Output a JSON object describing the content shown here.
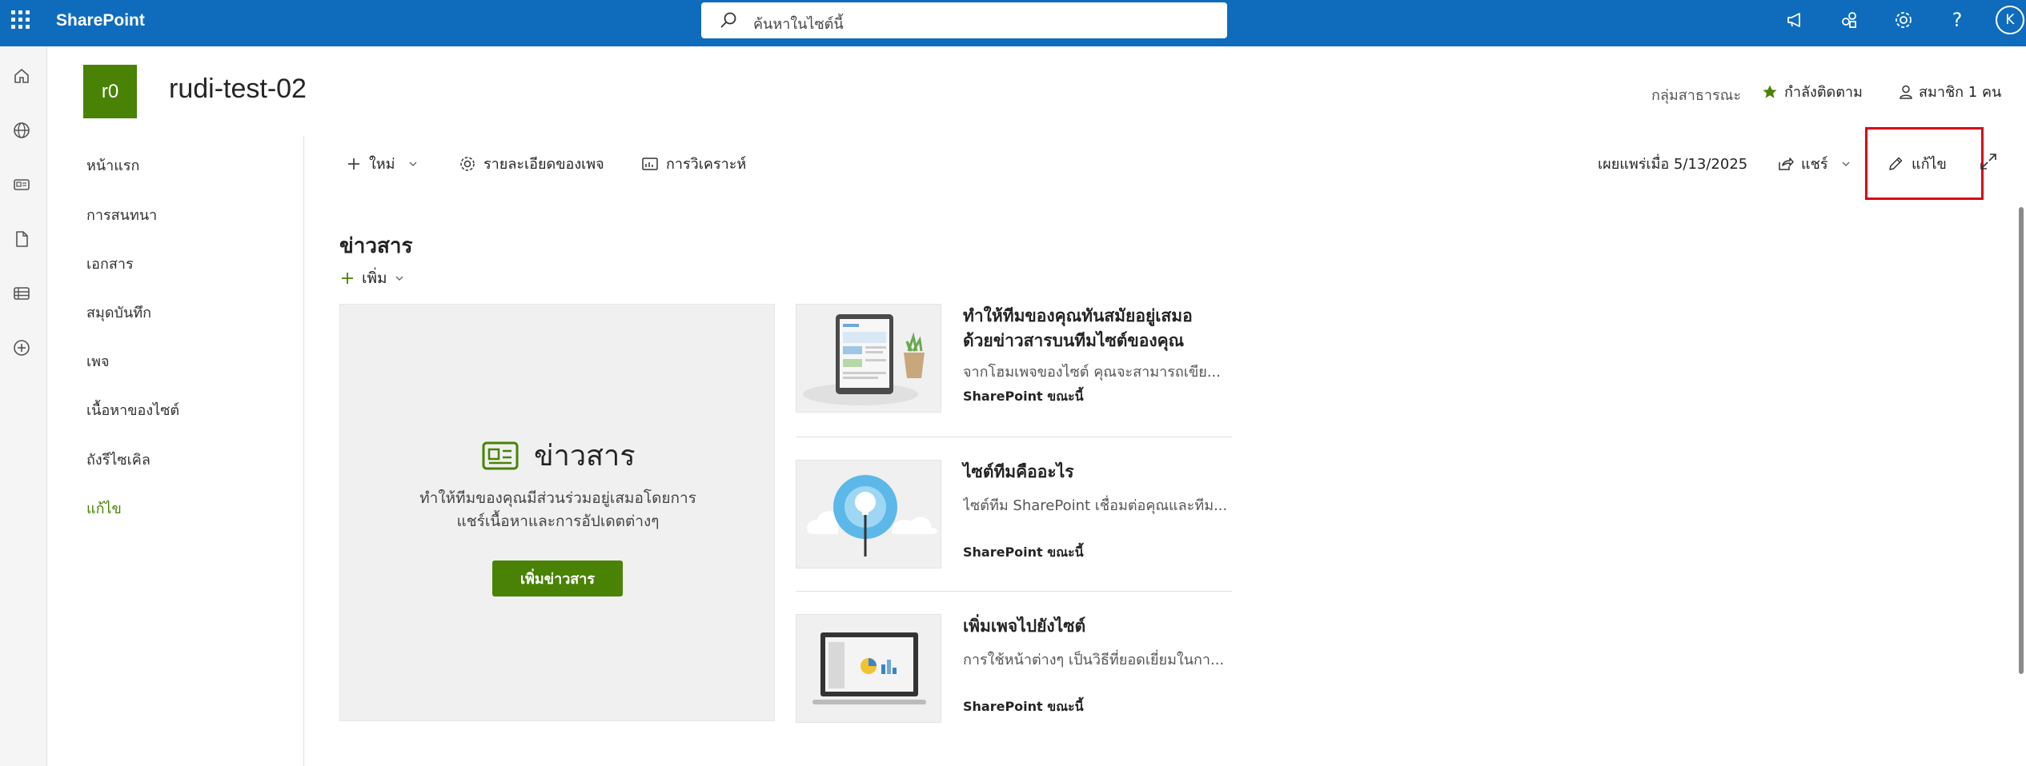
{
  "suite": {
    "brand": "SharePoint",
    "search_placeholder": "ค้นหาในไซต์นี้",
    "avatar_initial": "K"
  },
  "site": {
    "logo_text": "r0",
    "title": "rudi-test-02",
    "group_type": "กลุ่มสาธารณะ",
    "follow_label": "กำลังติดตาม",
    "members_label": "สมาชิก 1 คน"
  },
  "nav": {
    "items": [
      {
        "label": "หน้าแรก"
      },
      {
        "label": "การสนทนา"
      },
      {
        "label": "เอกสาร"
      },
      {
        "label": "สมุดบันทึก"
      },
      {
        "label": "เพจ"
      },
      {
        "label": "เนื้อหาของไซต์"
      },
      {
        "label": "ถังรีไซเคิล"
      },
      {
        "label": "แก้ไข"
      }
    ]
  },
  "commandbar": {
    "new_label": "ใหม่",
    "page_details_label": "รายละเอียดของเพจ",
    "analytics_label": "การวิเคราะห์",
    "published_label": "เผยแพร่เมื่อ 5/13/2025",
    "share_label": "แชร์",
    "edit_label": "แก้ไข"
  },
  "news": {
    "heading": "ข่าวสาร",
    "add_label": "เพิ่ม",
    "hero_title": "ข่าวสาร",
    "hero_desc_line1": "ทำให้ทีมของคุณมีส่วนร่วมอยู่เสมอโดยการ",
    "hero_desc_line2": "แชร์เนื้อหาและการอัปเดตต่างๆ",
    "hero_button": "เพิ่มข่าวสาร",
    "cards": [
      {
        "title_line1": "ทำให้ทีมของคุณทันสมัยอยู่เสมอ",
        "title_line2": "ด้วยข่าวสารบนทีมไซต์ของคุณ",
        "desc": "จากโฮมเพจของไซต์ คุณจะสามารถเขีย...",
        "meta": "SharePoint ขณะนี้"
      },
      {
        "title_line1": "ไซต์ทีมคืออะไร",
        "desc": "ไซต์ทีม SharePoint เชื่อมต่อคุณและทีม...",
        "meta": "SharePoint ขณะนี้"
      },
      {
        "title_line1": "เพิ่มเพจไปยังไซต์",
        "desc": "การใช้หน้าต่างๆ เป็นวิธีที่ยอดเยี่ยมในกา...",
        "meta": "SharePoint ขณะนี้"
      }
    ]
  },
  "colors": {
    "suite_bar": "#0f6cbd",
    "site_accent": "#498205",
    "highlight": "#d9001b"
  }
}
